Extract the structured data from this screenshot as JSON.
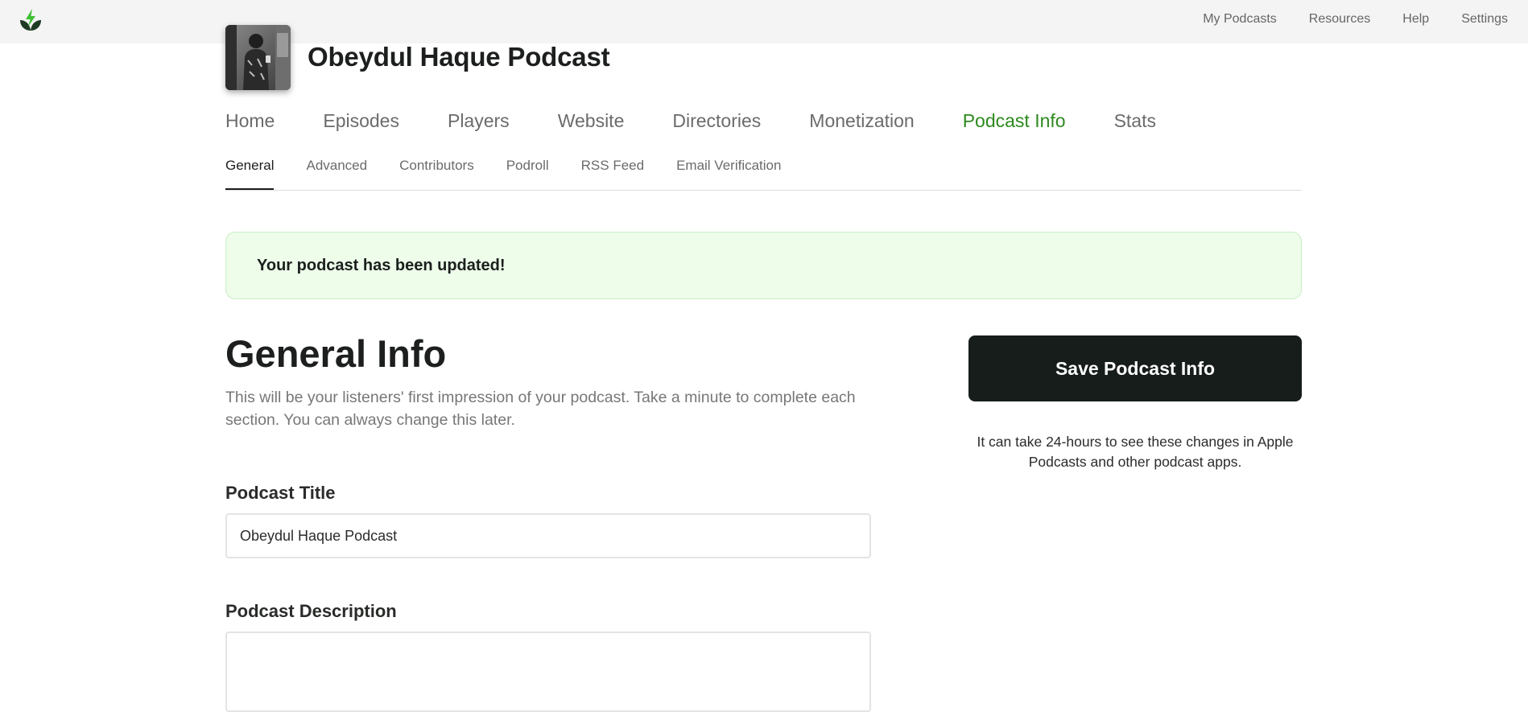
{
  "topbar": {
    "logo_icon": "leaf-lightning-logo",
    "nav": [
      "My Podcasts",
      "Resources",
      "Help",
      "Settings"
    ]
  },
  "podcast": {
    "name": "Obeydul Haque Podcast",
    "avatar_icon": "podcast-cover-photo"
  },
  "main_nav": {
    "items": [
      "Home",
      "Episodes",
      "Players",
      "Website",
      "Directories",
      "Monetization",
      "Podcast Info",
      "Stats"
    ],
    "active": "Podcast Info",
    "active_color": "#2d8a1e"
  },
  "sub_nav": {
    "items": [
      "General",
      "Advanced",
      "Contributors",
      "Podroll",
      "RSS Feed",
      "Email Verification"
    ],
    "active": "General"
  },
  "alert": {
    "message": "Your podcast has been updated!",
    "background_color": "#edfdea"
  },
  "general_info": {
    "title": "General Info",
    "description": "This will be your listeners' first impression of your podcast. Take a minute to complete each section. You can always change this later."
  },
  "form": {
    "podcast_title_label": "Podcast Title",
    "podcast_title_value": "Obeydul Haque Podcast",
    "podcast_description_label": "Podcast Description",
    "podcast_description_value": ""
  },
  "sidebar": {
    "save_label": "Save Podcast Info",
    "save_note": "It can take 24-hours to see these changes in Apple Podcasts and other podcast apps.",
    "button_color": "#161d1a"
  }
}
